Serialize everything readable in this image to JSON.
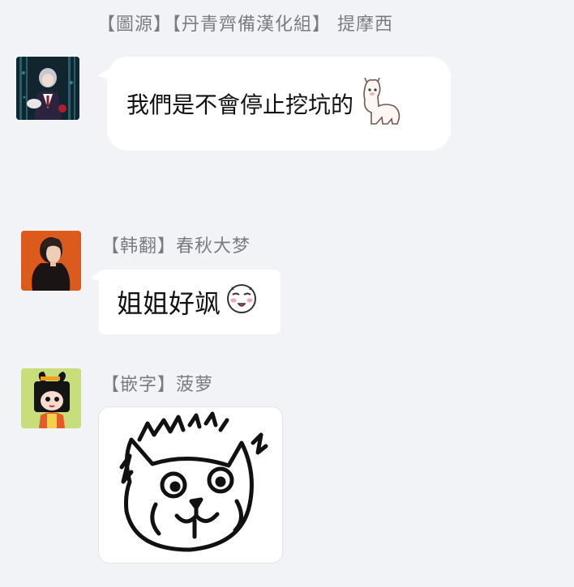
{
  "messages": [
    {
      "sender": "【圖源】【丹青齊備漢化組】 提摩西",
      "text": "我們是不會停止挖坑的",
      "emoji": "alpaca-emoji"
    },
    {
      "sender": "【韩翻】春秋大梦",
      "text": "姐姐好飒",
      "emoji": "blushing-face-emoji"
    },
    {
      "sender": "【嵌字】菠萝",
      "sticker": "cat-sticker"
    }
  ],
  "colors": {
    "background": "#f2f3f6",
    "bubble": "#ffffff",
    "sender_text": "#7a7c82"
  }
}
